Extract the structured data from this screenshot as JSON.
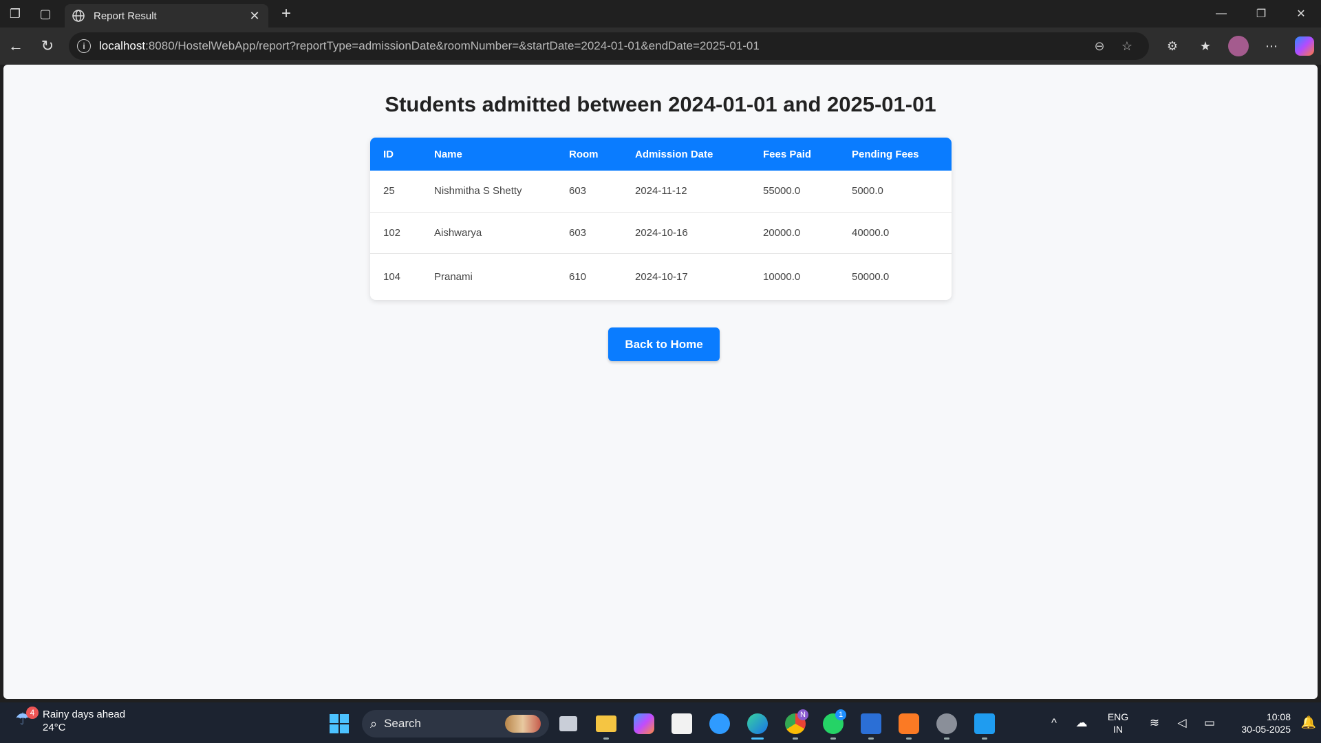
{
  "browser": {
    "tab_title": "Report Result",
    "url_host": "localhost",
    "url_rest": ":8080/HostelWebApp/report?reportType=admissionDate&roomNumber=&startDate=2024-01-01&endDate=2025-01-01"
  },
  "page": {
    "heading": "Students admitted between 2024-01-01 and 2025-01-01",
    "columns": [
      "ID",
      "Name",
      "Room",
      "Admission Date",
      "Fees Paid",
      "Pending Fees"
    ],
    "rows": [
      [
        "25",
        "Nishmitha S Shetty",
        "603",
        "2024-11-12",
        "55000.0",
        "5000.0"
      ],
      [
        "102",
        "Aishwarya",
        "603",
        "2024-10-16",
        "20000.0",
        "40000.0"
      ],
      [
        "104",
        "Pranami",
        "610",
        "2024-10-17",
        "10000.0",
        "50000.0"
      ]
    ],
    "back_button": "Back to Home"
  },
  "taskbar": {
    "weather_title": "Rainy days ahead",
    "weather_temp": "24°C",
    "weather_badge": "4",
    "search_label": "Search",
    "chrome_badge": "N",
    "whatsapp_badge": "1",
    "lang_line1": "ENG",
    "lang_line2": "IN",
    "time": "10:08",
    "date": "30-05-2025"
  },
  "colors": {
    "accent": "#0a7cff",
    "page_bg": "#f7f8fa",
    "chrome_bg": "#202020"
  }
}
